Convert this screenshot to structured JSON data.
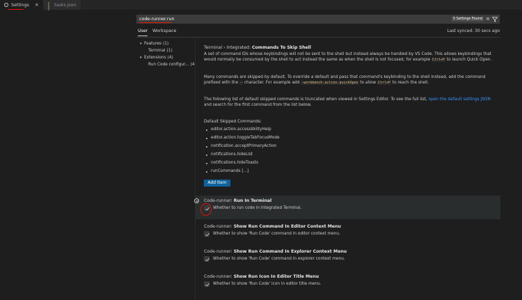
{
  "tabs": [
    {
      "label": "Settings",
      "icon": "gear-icon",
      "active": true
    },
    {
      "label": "tasks.json",
      "icon": "braces-icon",
      "active": false
    }
  ],
  "search": {
    "value": "code-runner.run",
    "results_badge": "5 Settings Found"
  },
  "scopes": {
    "user": "User",
    "workspace": "Workspace",
    "last_synced": "Last synced: 30 secs ago"
  },
  "toc": [
    {
      "label": "Features",
      "count": "(1)",
      "expanded": true
    },
    {
      "label": "Terminal",
      "count": "(1)"
    },
    {
      "label": "Extensions",
      "count": "(4)",
      "expanded": true
    },
    {
      "label": "Run Code configur...",
      "count": "(4)"
    }
  ],
  "skip_shell": {
    "category": "Terminal › Integrated: ",
    "name": "Commands To Skip Shell",
    "desc1": "A set of command IDs whose keybindings will not be sent to the shell but instead always be handled by VS Code. This allows keybindings that would normally be consumed by the shell to act instead the same as when the shell is not focused, for example ",
    "desc1_code": "Ctrl+P",
    "desc1_end": " to launch Quick Open.",
    "desc2_a": "Many commands are skipped by default. To override a default and pass that command's keybinding to the shell instead, add the command prefixed with the ",
    "desc2_code1": "-",
    "desc2_b": " character. For example add ",
    "desc2_code2": "-workbench.action.quickOpen",
    "desc2_c": " to allow ",
    "desc2_code3": "Ctrl+P",
    "desc2_d": " to reach the shell.",
    "desc3_a": "The following list of default skipped commands is truncated when viewed in Settings Editor. To see the full list, ",
    "desc3_link": "open the default settings JSON",
    "desc3_b": " and search for the first command from the list below.",
    "default_label": "Default Skipped Commands:",
    "commands": [
      "editor.action.accessibilityHelp",
      "editor.action.toggleTabFocusMode",
      "notification.acceptPrimaryAction",
      "notifications.hideList",
      "notifications.hideToasts",
      "runCommands [...]"
    ],
    "add_button": "Add Item"
  },
  "code_runner": [
    {
      "category": "Code-runner: ",
      "name": "Run In Terminal",
      "desc": "Whether to run code in Integrated Terminal.",
      "checked": true
    },
    {
      "category": "Code-runner: ",
      "name": "Show Run Command In Editor Context Menu",
      "desc": "Whether to show 'Run Code' command in editor context menu.",
      "checked": true
    },
    {
      "category": "Code-runner: ",
      "name": "Show Run Command In Explorer Context Menu",
      "desc": "Whether to show 'Run Code' command in explorer context menu.",
      "checked": true
    },
    {
      "category": "Code-runner: ",
      "name": "Show Run Icon In Editor Title Menu",
      "desc": "Whether to show 'Run Code' icon in editor title menu.",
      "checked": true
    }
  ],
  "colors": {
    "background": "#1e1e1e",
    "accent_button": "#0e639c",
    "link": "#3794ff",
    "annotation": "#e51400"
  }
}
